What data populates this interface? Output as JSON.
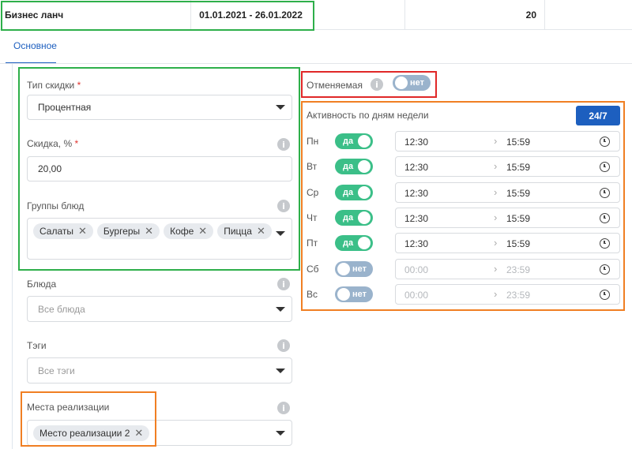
{
  "top_row": {
    "name": "Бизнес ланч",
    "dates": "01.01.2021 - 26.01.2022",
    "count": "20"
  },
  "tab": {
    "label": "Основное"
  },
  "form": {
    "discount_type": {
      "label": "Тип скидки",
      "required": "*",
      "value": "Процентная"
    },
    "discount": {
      "label": "Скидка, %",
      "required": "*",
      "value": "20,00"
    },
    "dish_groups": {
      "label": "Группы блюд",
      "chips": [
        "Салаты",
        "Бургеры",
        "Кофе",
        "Пицца"
      ]
    },
    "dishes": {
      "label": "Блюда",
      "placeholder": "Все блюда"
    },
    "tags": {
      "label": "Тэги",
      "placeholder": "Все тэги"
    },
    "places": {
      "label": "Места реализации",
      "chips": [
        "Место реализации 2"
      ]
    }
  },
  "cancellable": {
    "label": "Отменяемая",
    "toggle": "нет"
  },
  "activity": {
    "label": "Активность по дням недели",
    "button_247": "24/7",
    "days": [
      {
        "day": "Пн",
        "toggle": "да",
        "on": true,
        "from": "12:30",
        "to": "15:59"
      },
      {
        "day": "Вт",
        "toggle": "да",
        "on": true,
        "from": "12:30",
        "to": "15:59"
      },
      {
        "day": "Ср",
        "toggle": "да",
        "on": true,
        "from": "12:30",
        "to": "15:59"
      },
      {
        "day": "Чт",
        "toggle": "да",
        "on": true,
        "from": "12:30",
        "to": "15:59"
      },
      {
        "day": "Пт",
        "toggle": "да",
        "on": true,
        "from": "12:30",
        "to": "15:59"
      },
      {
        "day": "Сб",
        "toggle": "нет",
        "on": false,
        "from": "00:00",
        "to": "23:59"
      },
      {
        "day": "Вс",
        "toggle": "нет",
        "on": false,
        "from": "00:00",
        "to": "23:59"
      }
    ]
  },
  "colors": {
    "accent": "#1d5fbf",
    "toggle_on": "#3bbf88",
    "toggle_off": "#9ab3cc",
    "highlight_green": "#2eaf4a",
    "highlight_orange": "#f07f23",
    "highlight_red": "#e02828"
  }
}
